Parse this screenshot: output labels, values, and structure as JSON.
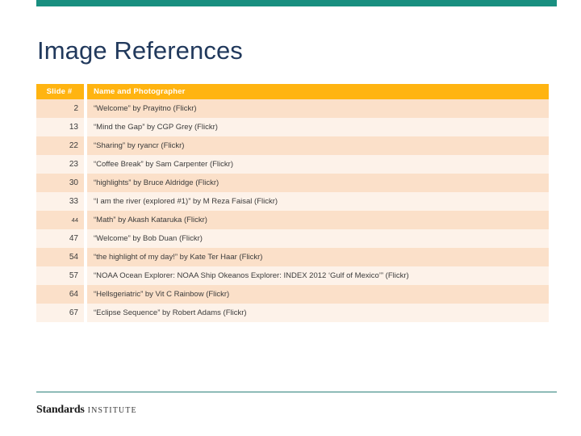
{
  "slide": {
    "title": "Image References",
    "accent_teal": "#198f80",
    "accent_orange": "#ffb411",
    "title_color": "#21395c",
    "row_color_odd": "#fbe0c9",
    "row_color_even": "#fdf2e9"
  },
  "table": {
    "headers": {
      "slide_number": "Slide  #",
      "name_and_photographer": "Name and Photographer"
    },
    "rows": [
      {
        "num": "2",
        "name": "“Welcome” by Prayitno (Flickr)"
      },
      {
        "num": "13",
        "name": "“Mind the Gap” by CGP Grey (Flickr)"
      },
      {
        "num": "22",
        "name": "“Sharing” by ryancr (Flickr)"
      },
      {
        "num": "23",
        "name": "“Coffee Break” by Sam Carpenter (Flickr)"
      },
      {
        "num": "30",
        "name": "“highlights” by Bruce Aldridge (Flickr)"
      },
      {
        "num": "33",
        "name": "“I am the river (explored #1)” by M Reza Faisal (Flickr)"
      },
      {
        "num": "44",
        "name": "“Math” by Akash Kataruka (Flickr)"
      },
      {
        "num": "47",
        "name": "“Welcome” by Bob Duan (Flickr)"
      },
      {
        "num": "54",
        "name": "“the highlight of my day!” by Kate Ter Haar (Flickr)"
      },
      {
        "num": "57",
        "name": "“NOAA Ocean Explorer: NOAA Ship Okeanos Explorer: INDEX 2012 ‘Gulf of Mexico’”  (Flickr)"
      },
      {
        "num": "64",
        "name": "“Hellsgeriatric” by Vit C Rainbow (Flickr)"
      },
      {
        "num": "67",
        "name": "“Eclipse Sequence” by Robert Adams (Flickr)"
      }
    ]
  },
  "footer": {
    "logo_primary": "Standards",
    "logo_secondary": "INSTITUTE"
  }
}
